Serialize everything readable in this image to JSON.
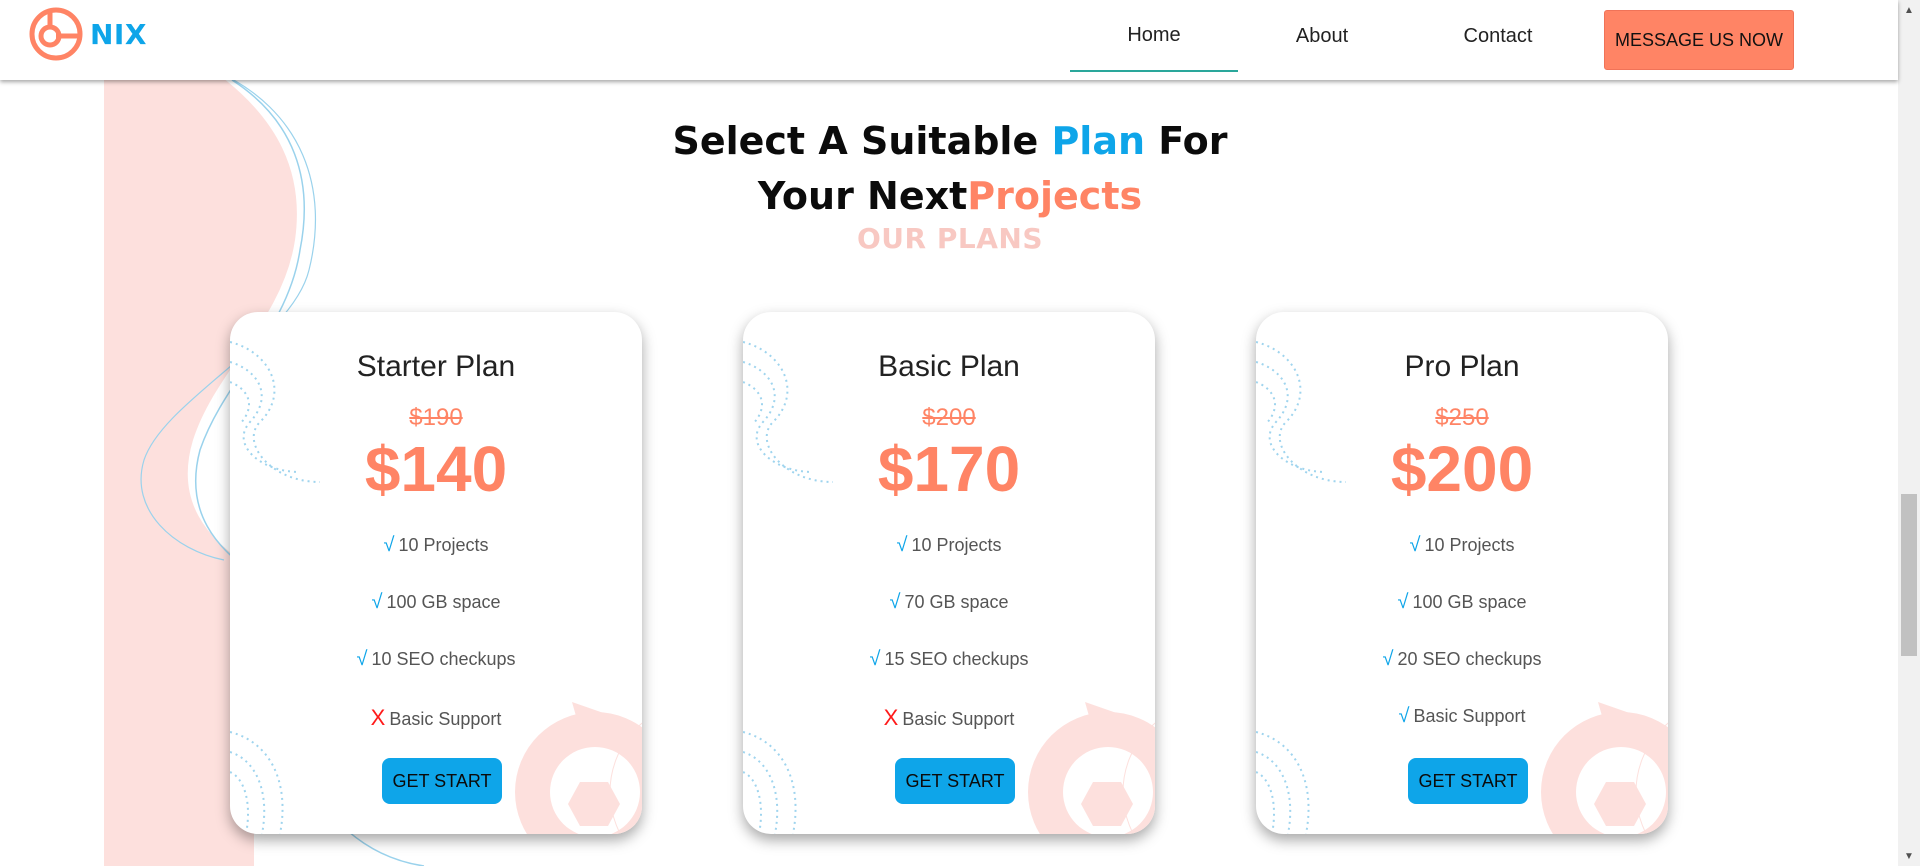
{
  "brand": {
    "name": "NIX"
  },
  "nav": {
    "items": [
      "Home",
      "About",
      "Contact"
    ],
    "cta": "MESSAGE US NOW"
  },
  "heading": {
    "part1": "Select A Suitable ",
    "highlight_blue": "Plan",
    "part2": " For",
    "part3": "Your Next",
    "highlight_orange": "Projects",
    "subtitle": "OUR PLANS"
  },
  "plans": [
    {
      "name": "Starter Plan",
      "old_price": "$190",
      "price": "$140",
      "features": [
        {
          "mark": "√",
          "text": "10 Projects",
          "included": true
        },
        {
          "mark": "√",
          "text": "100 GB space",
          "included": true
        },
        {
          "mark": "√",
          "text": "10 SEO checkups",
          "included": true
        },
        {
          "mark": "X",
          "text": "Basic Support",
          "included": false
        }
      ],
      "button": "GET START"
    },
    {
      "name": "Basic Plan",
      "old_price": "$200",
      "price": "$170",
      "features": [
        {
          "mark": "√",
          "text": "10 Projects",
          "included": true
        },
        {
          "mark": "√",
          "text": "70 GB space",
          "included": true
        },
        {
          "mark": "√",
          "text": "15 SEO checkups",
          "included": true
        },
        {
          "mark": "X",
          "text": "Basic Support",
          "included": false
        }
      ],
      "button": "GET START"
    },
    {
      "name": "Pro Plan",
      "old_price": "$250",
      "price": "$200",
      "features": [
        {
          "mark": "√",
          "text": "10 Projects",
          "included": true
        },
        {
          "mark": "√",
          "text": "100 GB space",
          "included": true
        },
        {
          "mark": "√",
          "text": "20 SEO checkups",
          "included": true
        },
        {
          "mark": "√",
          "text": "Basic Support",
          "included": true
        }
      ],
      "button": "GET START"
    }
  ],
  "colors": {
    "brand_blue": "#0ea5e9",
    "accent_orange": "#ff8465",
    "cross_red": "#ff1a1a",
    "soft_pink": "#fde0dd"
  },
  "icons": {
    "logo": "target-logo-icon",
    "check": "check-icon",
    "cross": "cross-icon"
  }
}
